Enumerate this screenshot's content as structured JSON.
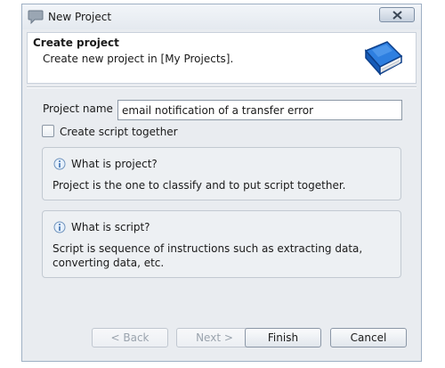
{
  "window": {
    "title": "New Project",
    "close_label": "X"
  },
  "header": {
    "title": "Create project",
    "subtitle": "Create new project in [My Projects]."
  },
  "form": {
    "project_name_label": "Project name",
    "project_name_value": "email notification of a transfer error",
    "create_script_label": "Create script together",
    "create_script_checked": false
  },
  "info": [
    {
      "title": "What is project?",
      "body": "Project is the one to classify and to put script together."
    },
    {
      "title": "What is script?",
      "body": "Script is sequence of instructions such as extracting data,\nconverting data, etc."
    }
  ],
  "buttons": {
    "back": "< Back",
    "next": "Next >",
    "finish": "Finish",
    "cancel": "Cancel"
  },
  "icons": {
    "app": "speech-bubble-icon",
    "header": "book-icon",
    "info": "info-icon",
    "close": "close-icon"
  },
  "colors": {
    "dialog_bg": "#e9ecf0",
    "accent": "#1e63c4"
  }
}
